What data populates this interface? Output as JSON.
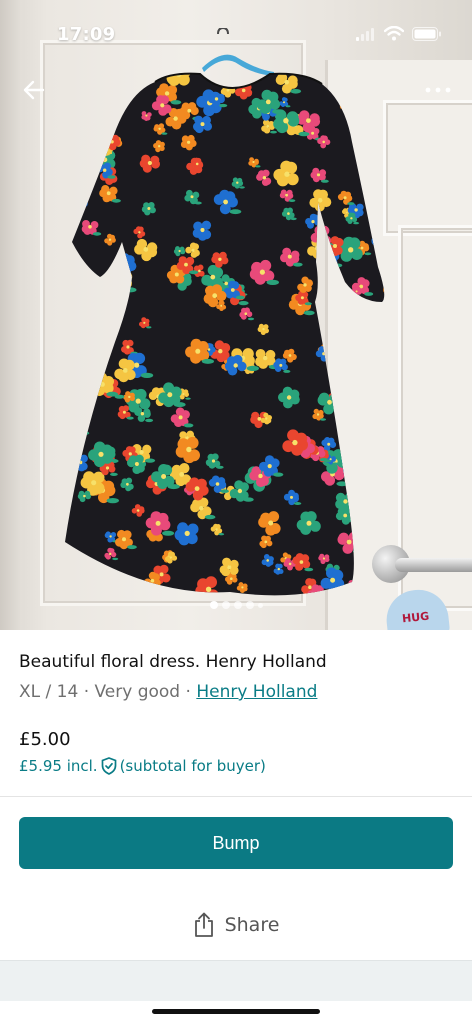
{
  "status_bar": {
    "time": "17:09"
  },
  "photo": {
    "dots_total": 5,
    "active_dot": 0
  },
  "listing": {
    "title": "Beautiful floral dress. Henry Holland",
    "size_condition": "XL / 14 · Very good · ",
    "brand": "Henry Holland",
    "price": "£5.00",
    "price_incl": "£5.95 incl.",
    "price_incl_note": "(subtotal for buyer)"
  },
  "actions": {
    "bump_label": "Bump",
    "share_label": "Share"
  },
  "decor": {
    "sign_text": "HUG"
  },
  "colors": {
    "accent": "#0b7a84",
    "link": "#0a7c86",
    "dress_base": "#1b1a1f",
    "flower_colors": [
      "#e9462f",
      "#f28a21",
      "#f5c542",
      "#1f6fd1",
      "#e84a7a",
      "#2aa37b"
    ]
  },
  "icons": {
    "back": "arrow-left-icon",
    "more": "more-horizontal-icon",
    "shield": "shield-check-icon",
    "share": "share-icon",
    "signal": "signal-icon",
    "wifi": "wifi-icon",
    "battery": "battery-icon"
  }
}
